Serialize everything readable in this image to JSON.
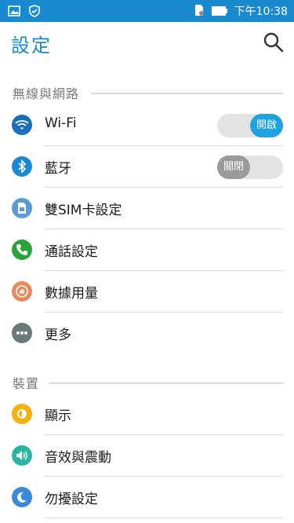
{
  "status_bar": {
    "time": "下午10:38",
    "left_icons": [
      "image-icon",
      "shield-icon"
    ],
    "right_icons": [
      "sim-icon",
      "battery-icon"
    ]
  },
  "app_bar": {
    "title": "設定",
    "search_icon": "search-icon"
  },
  "sections": [
    {
      "label": "無線與網路",
      "items": [
        {
          "label": "Wi-Fi",
          "icon": "wifi-icon",
          "icon_color": "#1a6fb8",
          "toggle": {
            "state": "on",
            "text": "開啟"
          }
        },
        {
          "label": "藍牙",
          "icon": "bluetooth-icon",
          "icon_color": "#1a8ad0",
          "toggle": {
            "state": "off",
            "text": "關閉"
          }
        },
        {
          "label": "雙SIM卡設定",
          "icon": "sim-card-icon",
          "icon_color": "#5b9bd5"
        },
        {
          "label": "通話設定",
          "icon": "phone-icon",
          "icon_color": "#2aa33a"
        },
        {
          "label": "數據用量",
          "icon": "data-usage-icon",
          "icon_color": "#e58a5f"
        },
        {
          "label": "更多",
          "icon": "more-icon",
          "icon_color": "#6a7a7a"
        }
      ]
    },
    {
      "label": "裝置",
      "items": [
        {
          "label": "顯示",
          "icon": "display-icon",
          "icon_color": "#f2b211"
        },
        {
          "label": "音效與震動",
          "icon": "sound-icon",
          "icon_color": "#2fb3a3"
        },
        {
          "label": "勿擾設定",
          "icon": "do-not-disturb-icon",
          "icon_color": "#3a8ad6"
        }
      ]
    }
  ],
  "colors": {
    "status_bar": "#1a8ad0",
    "title": "#1a8ad0",
    "toggle_on": "#1ea3e0",
    "toggle_off": "#9a9a9a"
  }
}
